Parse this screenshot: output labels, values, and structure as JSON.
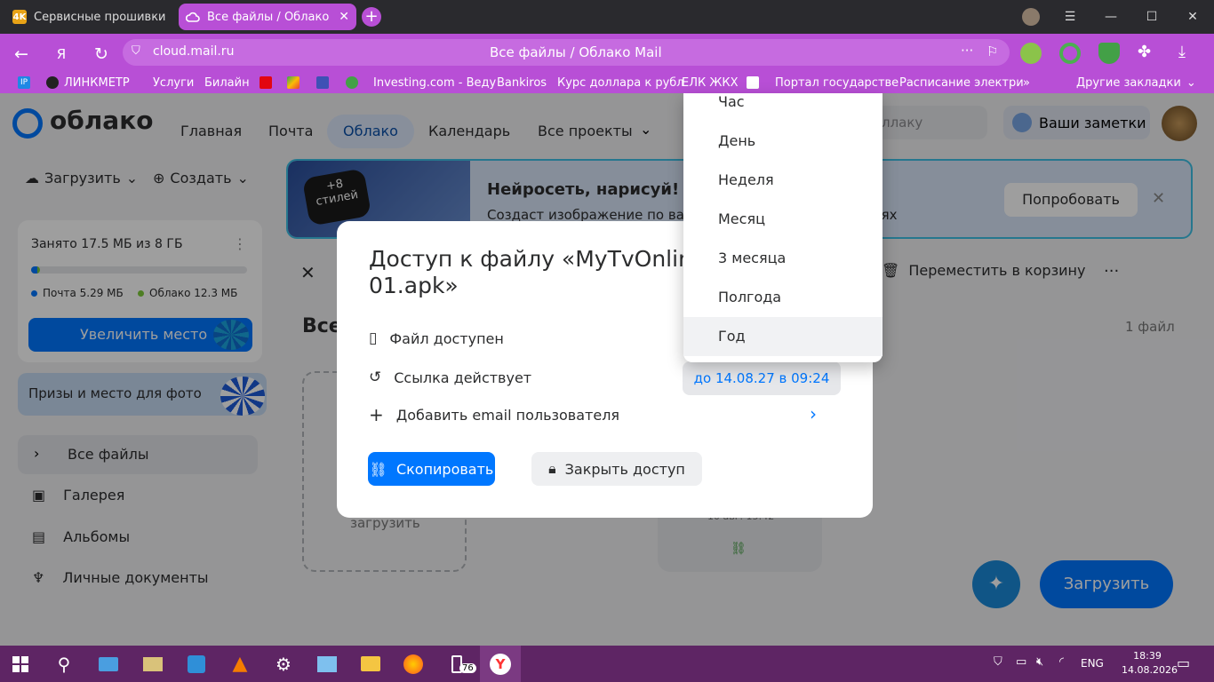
{
  "browser": {
    "tabs": [
      {
        "label": "Сервисные прошивки дл",
        "favicon": "4K"
      },
      {
        "label": "Все файлы / Облако Mail"
      }
    ],
    "address": "cloud.mail.ru",
    "page_title": "Все файлы / Облако Mail",
    "address_menu": "···",
    "bookmarks": [
      "ЛИНКМЕТР",
      "Услуги",
      "Билайн",
      "Investing.com - Веду",
      "Bankiros",
      "Курс доллара к рубл",
      "ЕЛК ЖКХ",
      "Портал государстве",
      "Расписание электри"
    ],
    "bookmarks_more": "»",
    "other_bookmarks": "Другие закладки"
  },
  "app": {
    "logo": "облако",
    "nav": [
      "Главная",
      "Почта",
      "Облако",
      "Календарь",
      "Все проекты"
    ],
    "search_placeholder": "ллаку",
    "notes": "Ваши заметки",
    "upload_menu": "Загрузить",
    "create_menu": "Создать",
    "storage": {
      "used": "Занято 17.5 МБ из 8 ГБ",
      "mail": "Почта 5.29 МБ",
      "cloud": "Облако 12.3 МБ",
      "fraction_used": 0.003
    },
    "increase": "Увеличить место",
    "prizes": "Призы и место для фото",
    "sidebar": [
      "Все файлы",
      "Галерея",
      "Альбомы",
      "Личные документы"
    ],
    "banner": {
      "badge_top": "+8",
      "badge_bottom": "стилей",
      "title": "Нейросеть, нарисуй!",
      "text": "Создаст изображение по ва",
      "text_end": "лях",
      "button": "Попробовать"
    },
    "toolbar_delete": "Переместить в корзину",
    "toolbar_more": "···",
    "section_title": "Все",
    "file_count": "1 файл",
    "drop_text": "загрузить",
    "card_date": "10 авг. 15:42",
    "upload_button": "Загрузить"
  },
  "modal": {
    "title_line1": "Доступ к файлу «MyTvOnline",
    "title_line2": "01.apk»",
    "file_available": "Файл доступен",
    "link_valid": "Ссылка действует",
    "link_until": "до 14.08.27 в 09:24",
    "add_email": "Добавить email пользователя",
    "copy_button": "Скопировать",
    "close_access_button": "Закрыть доступ"
  },
  "dropdown": {
    "options": [
      "Час",
      "День",
      "Неделя",
      "Месяц",
      "3 месяца",
      "Полгода",
      "Год"
    ],
    "highlighted": "Год"
  },
  "taskbar": {
    "badge": "76",
    "lang": "ENG",
    "time": "18:39",
    "date": "14.08.2026"
  },
  "colors": {
    "accent": "#0077ff",
    "browser": "#b84fd6",
    "taskbar": "#5e2564"
  }
}
